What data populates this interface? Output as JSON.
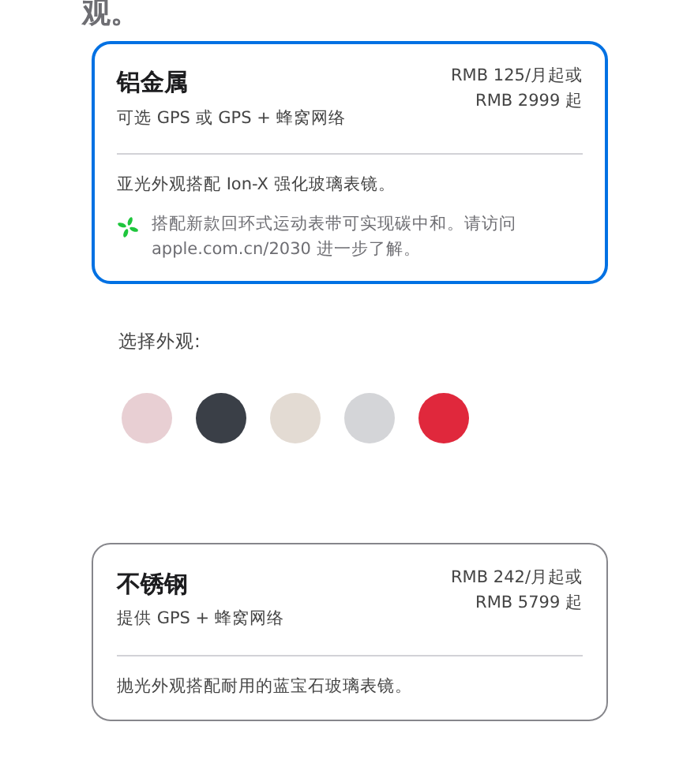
{
  "heading": "观。",
  "models": [
    {
      "name": "铝金属",
      "subtitle": "可选 GPS 或 GPS + 蜂窝网络",
      "price_monthly": "RMB 125/月起或",
      "price_full": "RMB 2999 起",
      "selected": true,
      "notes": [
        {
          "kind": "text",
          "text": "亚光外观搭配 Ion-X 强化玻璃表镜。"
        },
        {
          "kind": "eco",
          "text": "搭配新款回环式运动表带可实现碳中和。请访问 apple.com.cn/2030 进一步了解。"
        }
      ]
    }
  ],
  "finish_label": "选择外观:",
  "swatches": [
    {
      "color": "#e8cfd3"
    },
    {
      "color": "#3a3f47"
    },
    {
      "color": "#e3dbd3"
    },
    {
      "color": "#d4d5d8"
    },
    {
      "color": "#e0283c"
    }
  ],
  "models_2": [
    {
      "name": "不锈钢",
      "subtitle": "提供 GPS + 蜂窝网络",
      "price_monthly": "RMB 242/月起或",
      "price_full": "RMB 5799 起",
      "selected": false,
      "notes": [
        {
          "kind": "text",
          "text": "抛光外观搭配耐用的蓝宝石玻璃表镜。"
        }
      ]
    }
  ]
}
